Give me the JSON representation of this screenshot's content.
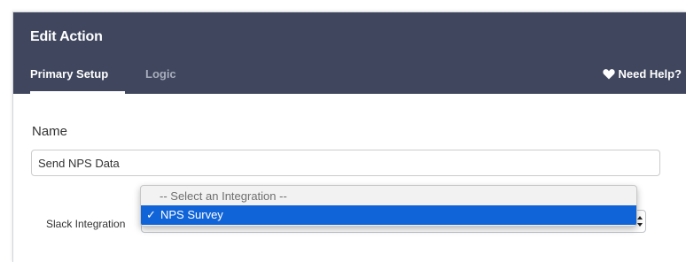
{
  "dialog": {
    "title": "Edit Action",
    "tabs": [
      {
        "label": "Primary Setup",
        "active": true
      },
      {
        "label": "Logic",
        "active": false
      }
    ],
    "help": {
      "label": "Need Help?",
      "icon": "heart-icon"
    }
  },
  "form": {
    "name": {
      "label": "Name",
      "value": "Send NPS Data"
    },
    "integration": {
      "label": "Slack Integration",
      "selected": "NPS Survey",
      "options": [
        {
          "label": "-- Select an Integration --",
          "selected": false
        },
        {
          "label": "NPS Survey",
          "selected": true,
          "check": "✓"
        }
      ]
    }
  },
  "colors": {
    "header_bg": "#3f465d",
    "tab_inactive": "#a9aebd",
    "highlight": "#1164d8"
  }
}
